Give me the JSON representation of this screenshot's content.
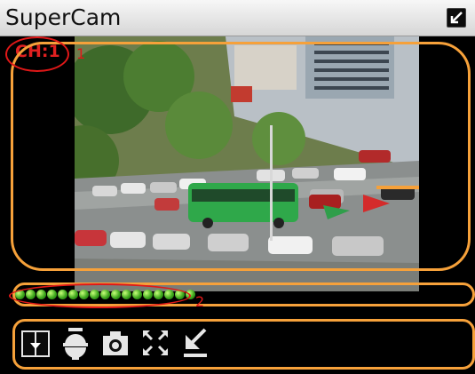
{
  "app": {
    "title": "SuperCam"
  },
  "camera": {
    "channel_label": "CH:1"
  },
  "annotations": {
    "marker_1": "1",
    "marker_2": "2"
  },
  "progress": {
    "dot_count": 17,
    "dot_color": "#3ea81d"
  },
  "toolbar": {
    "buttons": [
      {
        "name": "channel-select-icon"
      },
      {
        "name": "ptz-camera-icon"
      },
      {
        "name": "snapshot-camera-icon"
      },
      {
        "name": "fullscreen-icon"
      },
      {
        "name": "record-download-icon"
      }
    ]
  },
  "colors": {
    "annotation_orange": "#f6a13a",
    "annotation_red": "#e01818",
    "bus_green": "#2fa84a"
  }
}
